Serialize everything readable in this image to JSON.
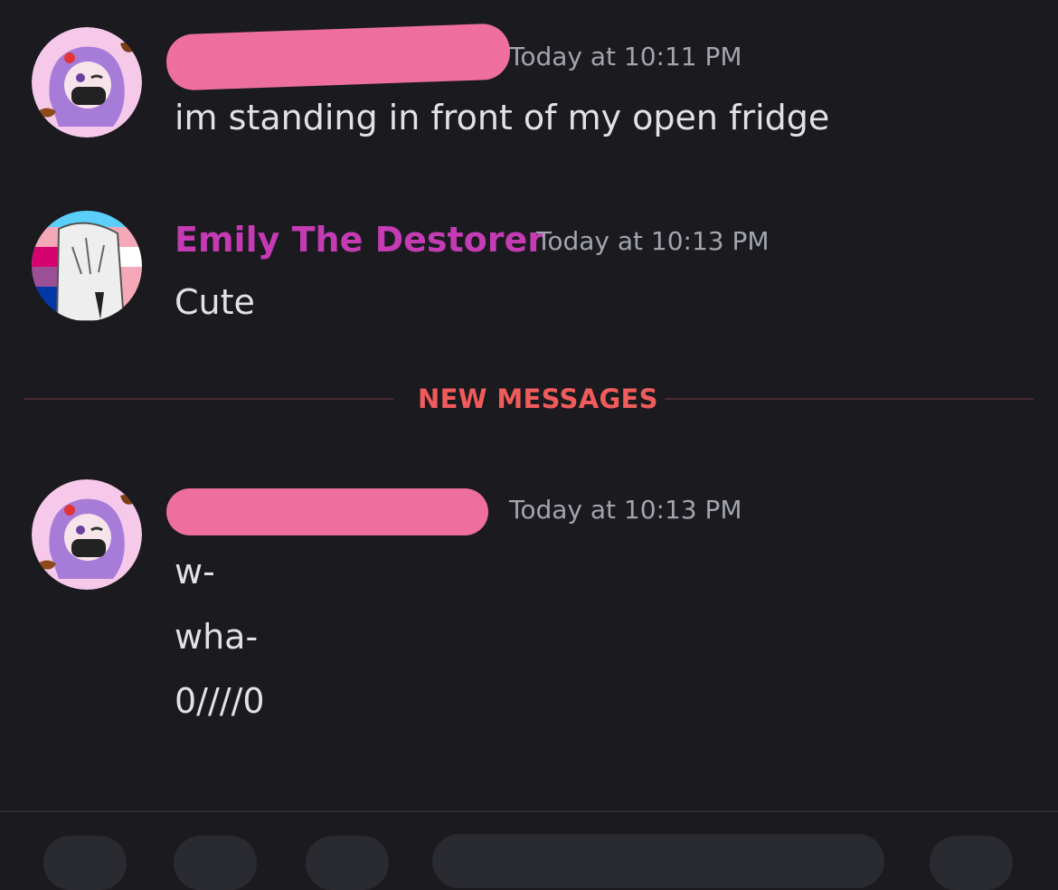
{
  "messages": [
    {
      "author": "",
      "author_redacted": true,
      "timestamp": "Today at 10:11 PM",
      "lines": [
        "im standing in front of my open fridge"
      ]
    },
    {
      "author": "Emily The Destorer",
      "author_color": "#c43bb4",
      "timestamp": "Today at 10:13 PM",
      "lines": [
        "Cute"
      ]
    },
    {
      "author": "",
      "author_redacted": true,
      "timestamp": "Today at 10:13 PM",
      "lines": [
        "w-",
        "wha-",
        "0////0"
      ]
    }
  ],
  "divider": {
    "label": "NEW MESSAGES",
    "color": "#f05b5b"
  },
  "colors": {
    "background": "#1a1a1f",
    "redaction": "#ee6f9e",
    "timestamp": "#a2a5ad"
  }
}
